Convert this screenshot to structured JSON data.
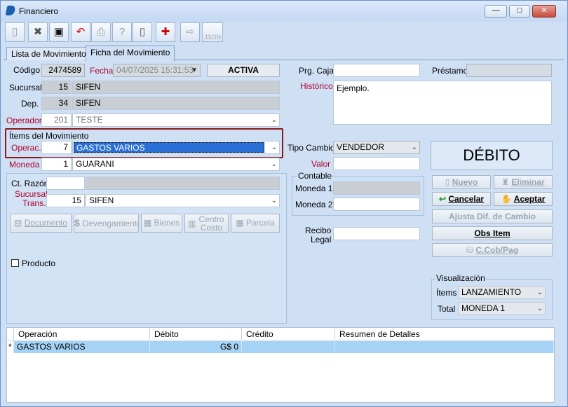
{
  "window": {
    "title": "Financiero",
    "minimize": "—",
    "maximize": "□",
    "close": "✕"
  },
  "toolbar": {
    "icons": [
      "new-icon",
      "cancel-icon",
      "save-icon",
      "undo-icon",
      "print-icon",
      "help-icon",
      "document-icon",
      "delete-icon",
      "export-icon",
      "json-icon"
    ],
    "json_label": "JSON"
  },
  "tabs": [
    {
      "label": "Lista de Movimientos"
    },
    {
      "label": "Ficha del Movimiento"
    }
  ],
  "form": {
    "codigo_label": "Código",
    "codigo": "2474589",
    "fecha_label": "Fecha",
    "fecha": "04/07/2025 15:31:53",
    "status": "ACTIVA",
    "sucursal_label": "Sucursal",
    "sucursal_code": "15",
    "sucursal_name": "SIFEN",
    "dep_label": "Dep.",
    "dep_code": "34",
    "dep_name": "SIFEN",
    "operador_label": "Operador",
    "operador_code": "201",
    "operador_name": "TESTE",
    "items_group": "Ítems del Movimiento",
    "operac_label": "Operac.",
    "operac_code": "7",
    "operac_name": "GASTOS VARIOS",
    "moneda_label": "Moneda",
    "moneda_code": "1",
    "moneda_name": "GUARANI",
    "ctrazon_label": "Ct. Razón",
    "ctrazon": "",
    "sucursal_trans_label1": "Sucursal",
    "sucursal_trans_label2": "Trans.",
    "sucursal_trans_code": "15",
    "sucursal_trans_name": "SIFEN",
    "buttons": {
      "documento": "Documento",
      "devengamiento": "Devengamiento",
      "bienes": "Bienes",
      "centro_costo1": "Centro",
      "centro_costo2": "Costo",
      "parcela": "Parcela"
    },
    "producto_label": "Producto",
    "prg_caja_label": "Prg. Caja",
    "prg_caja": "",
    "prestamo_label": "Préstamo",
    "prestamo": "",
    "historico_label": "Histórico",
    "historico": "Ejemplo.",
    "tipo_cambio_label": "Tipo Cambio",
    "tipo_cambio": "VENDEDOR",
    "valor_label": "Valor",
    "valor": "",
    "contable_label": "Contable",
    "moneda1_label": "Moneda 1",
    "moneda1": "",
    "moneda2_label": "Moneda 2",
    "moneda2": "",
    "recibo_label1": "Recibo",
    "recibo_label2": "Legal",
    "recibo": "",
    "debito_title": "DÉBITO",
    "nuevo": "Nuevo",
    "eliminar": "Eliminar",
    "cancelar": "Cancelar",
    "aceptar": "Aceptar",
    "ajusta": "Ajusta Dif. de Cambio",
    "obs_item": "Obs Item",
    "ccob": "C.Cob/Pag",
    "visualizacion_label": "Visualización",
    "items_label": "Ítems",
    "items_value": "LANZAMIENTO",
    "total_label": "Total",
    "total_value": "MONEDA 1"
  },
  "grid": {
    "headers": [
      "Operación",
      "Débito",
      "Crédito",
      "Resumen de Detalles"
    ],
    "rows": [
      {
        "marker": "*",
        "operacion": "GASTOS VARIOS",
        "debito": "G$ 0",
        "credito": "",
        "resumen": ""
      }
    ]
  },
  "colors": {
    "accent": "#2a6fd6",
    "highlight_border": "#8a1a1a",
    "label_red": "#b0002a"
  }
}
